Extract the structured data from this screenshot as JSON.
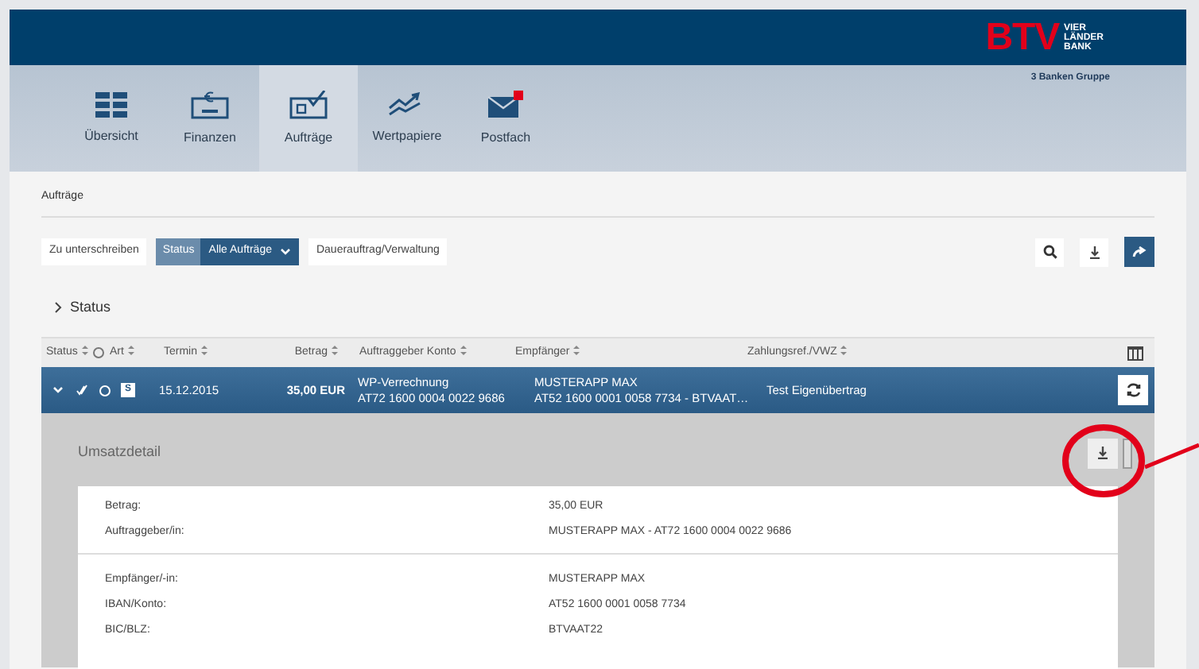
{
  "logo": {
    "mark": "BTV",
    "name": [
      "VIER",
      "LÄNDER",
      "BANK"
    ],
    "group": "3 Banken Gruppe"
  },
  "nav": [
    {
      "label": "Übersicht",
      "selected": false,
      "kind": "grid"
    },
    {
      "label": "Finanzen",
      "selected": false,
      "kind": "money"
    },
    {
      "label": "Aufträge",
      "selected": true,
      "kind": "order"
    },
    {
      "label": "Wertpapiere",
      "selected": false,
      "kind": "chart"
    },
    {
      "label": "Postfach",
      "selected": false,
      "kind": "mail",
      "badge": true
    }
  ],
  "breadcrumb": "Aufträge",
  "toolbar": {
    "sign": "Zu unterschreiben",
    "status_label": "Status",
    "status_value": "Alle Aufträge",
    "standing": "Dauerauftrag/Verwaltung"
  },
  "section": {
    "label": "Status",
    "expanded": false
  },
  "table": {
    "columns": [
      "Status",
      "Art",
      "Termin",
      "Betrag",
      "Auftraggeber Konto",
      "Empfänger",
      "Zahlungsref./VWZ"
    ],
    "rows": [
      {
        "selected": true,
        "expanded": true,
        "type": "S",
        "date": "15.12.2015",
        "amount": "35,00 EUR",
        "account": [
          "WP-Verrechnung",
          "AT72 1600 0004 0022 9686"
        ],
        "recipient": [
          "MUSTERAPP MAX",
          "AT52 1600 0001 0058 7734 - BTVAAT…"
        ],
        "reference": "Test Eigenübertrag"
      }
    ]
  },
  "detail": {
    "title": "Umsatzdetail",
    "groups": [
      [
        {
          "label": "Betrag:",
          "value": "35,00 EUR"
        },
        {
          "label": "Auftraggeber/in:",
          "value": "MUSTERAPP MAX - AT72 1600 0004 0022 9686"
        }
      ],
      [
        {
          "label": "Empfänger/-in:",
          "value": "MUSTERAPP MAX"
        },
        {
          "label": "IBAN/Konto:",
          "value": "AT52 1600 0001 0058 7734"
        },
        {
          "label": "BIC/BLZ:",
          "value": "BTVAAT22"
        }
      ]
    ]
  }
}
